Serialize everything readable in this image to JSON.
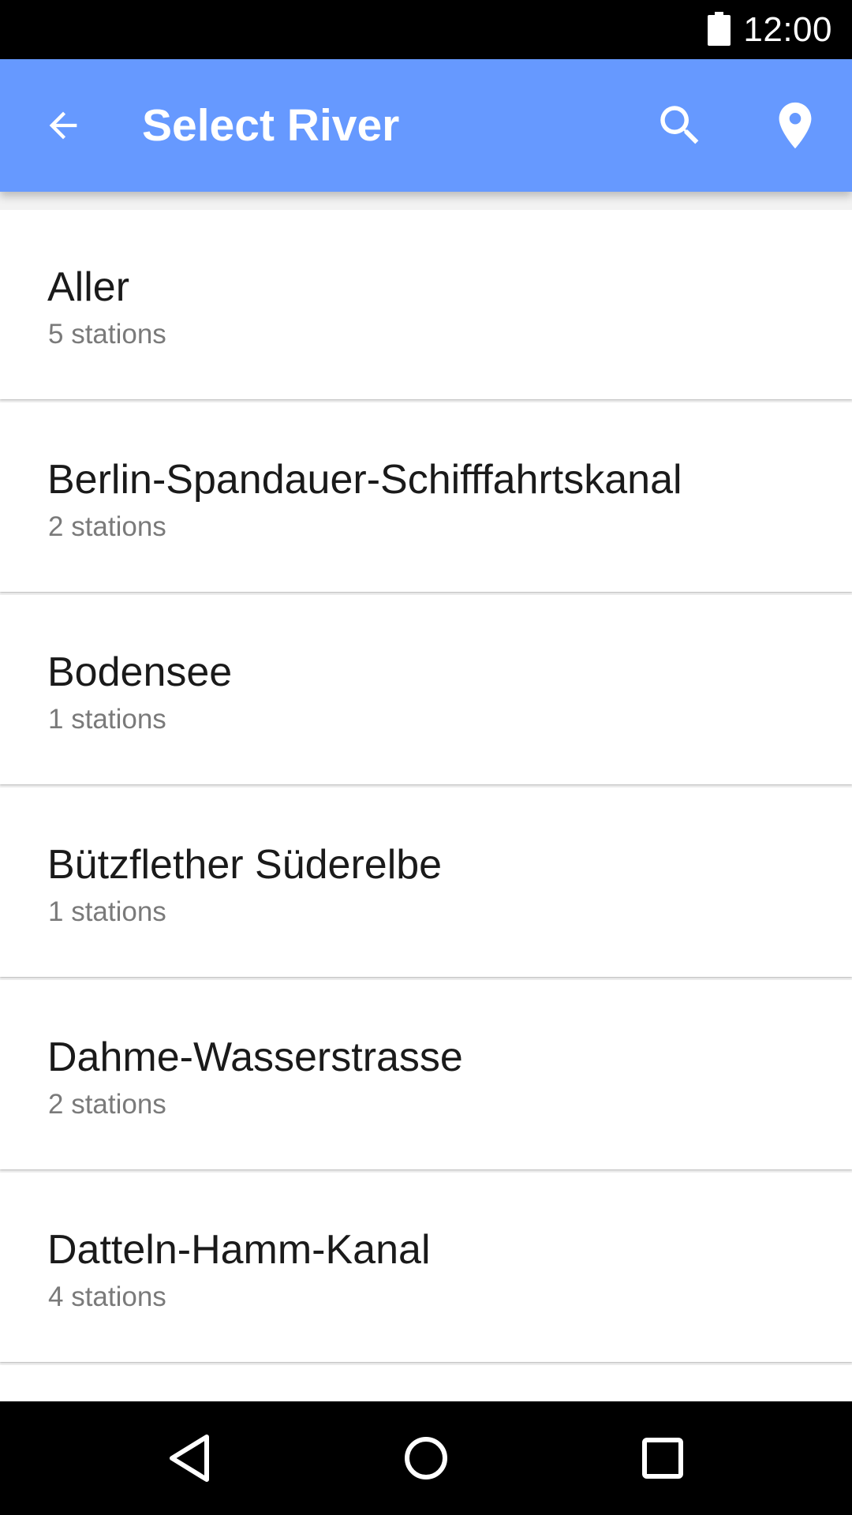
{
  "status_bar": {
    "time": "12:00",
    "battery_icon": "battery-full-icon"
  },
  "app_bar": {
    "title": "Select River",
    "background_color": "#6699ff",
    "back_icon": "arrow-back-icon",
    "search_icon": "search-icon",
    "location_icon": "location-pin-icon"
  },
  "rivers": [
    {
      "name": "Aller",
      "count": "5 stations"
    },
    {
      "name": "Berlin-Spandauer-Schifffahrtskanal",
      "count": "2 stations"
    },
    {
      "name": "Bodensee",
      "count": "1 stations"
    },
    {
      "name": "Bützflether Süderelbe",
      "count": "1 stations"
    },
    {
      "name": "Dahme-Wasserstrasse",
      "count": "2 stations"
    },
    {
      "name": "Datteln-Hamm-Kanal",
      "count": "4 stations"
    },
    {
      "name": "",
      "count": ""
    }
  ],
  "nav_bar": {
    "back_icon": "nav-back-triangle-icon",
    "home_icon": "nav-home-circle-icon",
    "recents_icon": "nav-recents-square-icon"
  }
}
